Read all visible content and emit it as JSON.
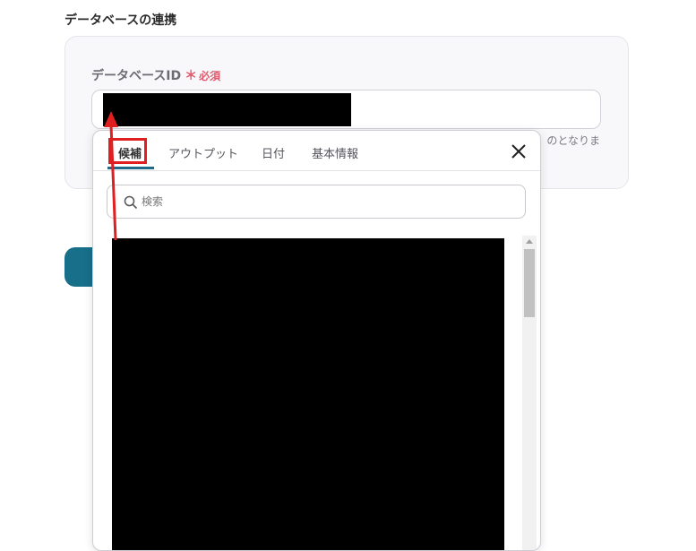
{
  "section": {
    "title": "データベースの連携"
  },
  "field": {
    "label": "データベースID",
    "required_star": "＊",
    "required_text": "必須",
    "hint": "のとなりま"
  },
  "popup": {
    "tabs": [
      {
        "label": "候補",
        "active": true
      },
      {
        "label": "アウトプット",
        "active": false
      },
      {
        "label": "日付",
        "active": false
      },
      {
        "label": "基本情報",
        "active": false
      }
    ],
    "close_icon": "close-icon",
    "search": {
      "placeholder": "検索",
      "value": ""
    }
  },
  "colors": {
    "accent": "#176f8a",
    "required": "#e05a6d",
    "highlight": "#e02020"
  }
}
